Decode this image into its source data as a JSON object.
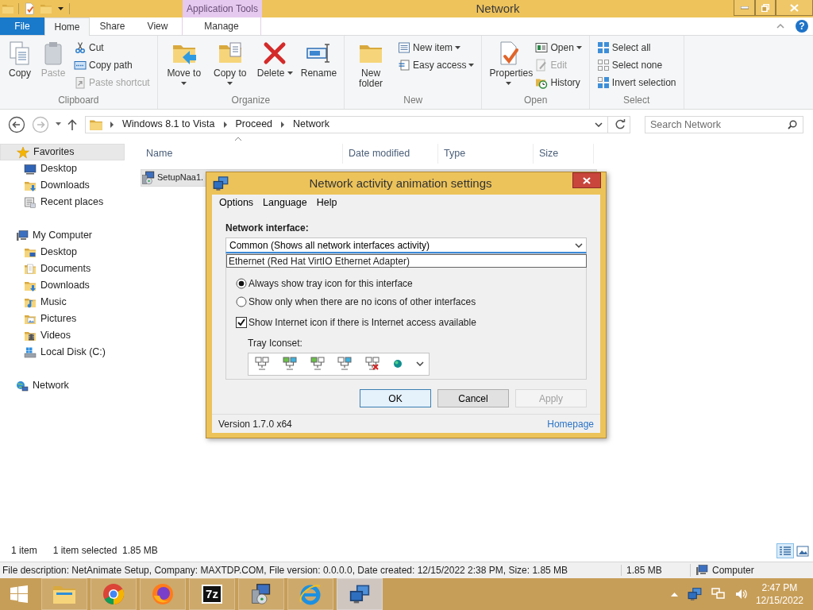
{
  "titlebar": {
    "context_tab": "Application Tools",
    "title": "Network"
  },
  "ribbon_tabs": [
    {
      "label": "File",
      "kind": "file",
      "selected": false
    },
    {
      "label": "Home",
      "kind": "tab",
      "selected": true
    },
    {
      "label": "Share",
      "kind": "tab",
      "selected": false
    },
    {
      "label": "View",
      "kind": "tab",
      "selected": false
    },
    {
      "label": "Manage",
      "kind": "context",
      "selected": false
    }
  ],
  "help": "?",
  "ribbon_groups": [
    {
      "label": "Clipboard",
      "columns": [
        {
          "kind": "large",
          "label": "Copy",
          "disabled": false,
          "dropdown": false
        },
        {
          "kind": "large",
          "label": "Paste",
          "disabled": true,
          "dropdown": false
        },
        {
          "kind": "stack",
          "items": [
            {
              "label": "Cut",
              "disabled": false,
              "dropdown": false
            },
            {
              "label": "Copy path",
              "disabled": false,
              "dropdown": false
            },
            {
              "label": "Paste shortcut",
              "disabled": true,
              "dropdown": false
            }
          ]
        }
      ]
    },
    {
      "label": "Organize",
      "columns": [
        {
          "kind": "large",
          "label": "Move to",
          "disabled": false,
          "dropdown": true
        },
        {
          "kind": "large",
          "label": "Copy to",
          "disabled": false,
          "dropdown": true
        },
        {
          "kind": "large",
          "label": "Delete",
          "disabled": false,
          "dropdown": true
        },
        {
          "kind": "large",
          "label": "Rename",
          "disabled": false,
          "dropdown": false
        }
      ]
    },
    {
      "label": "New",
      "columns": [
        {
          "kind": "large",
          "label": "New folder",
          "disabled": false,
          "dropdown": false
        },
        {
          "kind": "stack",
          "items": [
            {
              "label": "New item",
              "disabled": false,
              "dropdown": true
            },
            {
              "label": "Easy access",
              "disabled": false,
              "dropdown": true
            }
          ]
        }
      ]
    },
    {
      "label": "Open",
      "columns": [
        {
          "kind": "large",
          "label": "Properties",
          "disabled": false,
          "dropdown": true
        },
        {
          "kind": "stack",
          "items": [
            {
              "label": "Open",
              "disabled": false,
              "dropdown": true
            },
            {
              "label": "Edit",
              "disabled": true,
              "dropdown": false
            },
            {
              "label": "History",
              "disabled": false,
              "dropdown": false
            }
          ]
        }
      ]
    },
    {
      "label": "Select",
      "columns": [
        {
          "kind": "stack",
          "items": [
            {
              "label": "Select all",
              "disabled": false,
              "dropdown": false
            },
            {
              "label": "Select none",
              "disabled": false,
              "dropdown": false
            },
            {
              "label": "Invert selection",
              "disabled": false,
              "dropdown": false
            }
          ]
        }
      ]
    }
  ],
  "address": {
    "segments": [
      "Windows 8.1 to Vista",
      "Proceed",
      "Network"
    ],
    "search_placeholder": "Search Network"
  },
  "nav_tree": [
    {
      "label": "Favorites",
      "selected": true,
      "children": [
        {
          "label": "Desktop",
          "selected": false
        },
        {
          "label": "Downloads",
          "selected": false
        },
        {
          "label": "Recent places",
          "selected": false
        }
      ]
    },
    {
      "label": "My Computer",
      "selected": false,
      "children": [
        {
          "label": "Desktop",
          "selected": false
        },
        {
          "label": "Documents",
          "selected": false
        },
        {
          "label": "Downloads",
          "selected": false
        },
        {
          "label": "Music",
          "selected": false
        },
        {
          "label": "Pictures",
          "selected": false
        },
        {
          "label": "Videos",
          "selected": false
        },
        {
          "label": "Local Disk (C:)",
          "selected": false
        }
      ]
    },
    {
      "label": "Network",
      "selected": false
    }
  ],
  "file_list": {
    "columns": [
      "Name",
      "Date modified",
      "Type",
      "Size"
    ],
    "rows": [
      {
        "name": "SetupNaa1.",
        "selected": true
      }
    ]
  },
  "status_bar": {
    "item_count": "1 item",
    "selection": "1 item selected  1.85 MB",
    "view_buttons": [
      {
        "kind": "details",
        "selected": true
      },
      {
        "kind": "large-icons",
        "selected": false
      }
    ]
  },
  "details_bar": {
    "description": "File description: NetAnimate Setup, Company: MAXTDP.COM, File version: 0.0.0.0, Date created: 12/15/2022 2:38 PM, Size: 1.85 MB",
    "size": "1.85 MB",
    "zone": "Computer"
  },
  "dialog": {
    "title": "Network activity animation settings",
    "menu": [
      "Options",
      "Language",
      "Help"
    ],
    "interface_label": "Network interface:",
    "interface_value": "Common (Shows all network interfaces activity)",
    "dropdown_options": [
      "Ethernet (Red Hat VirtIO Ethernet Adapter)"
    ],
    "options": [
      {
        "kind": "radio",
        "label": "Always show tray icon for this interface",
        "selected": true
      },
      {
        "kind": "radio",
        "label": "Show only when there are no icons of other interfaces",
        "selected": false
      },
      {
        "kind": "checkbox",
        "label": "Show Internet icon if there is Internet access available",
        "checked": true
      }
    ],
    "iconset_label": "Tray Iconset:",
    "buttons": [
      {
        "label": "OK",
        "kind": "default",
        "disabled": false
      },
      {
        "label": "Cancel",
        "kind": "normal",
        "disabled": false
      },
      {
        "label": "Apply",
        "kind": "normal",
        "disabled": true
      }
    ],
    "version": "Version 1.7.0 x64",
    "homepage": "Homepage"
  },
  "taskbar": {
    "apps": [
      {
        "kind": "explorer",
        "selected": false
      },
      {
        "kind": "chrome",
        "selected": false
      },
      {
        "kind": "firefox",
        "selected": false
      },
      {
        "kind": "sevenzip",
        "text": "7z",
        "selected": false
      },
      {
        "kind": "installer",
        "selected": false
      },
      {
        "kind": "ie",
        "selected": false
      },
      {
        "kind": "netanimate",
        "selected": true
      }
    ],
    "time": "2:47 PM",
    "date": "12/15/2022"
  }
}
